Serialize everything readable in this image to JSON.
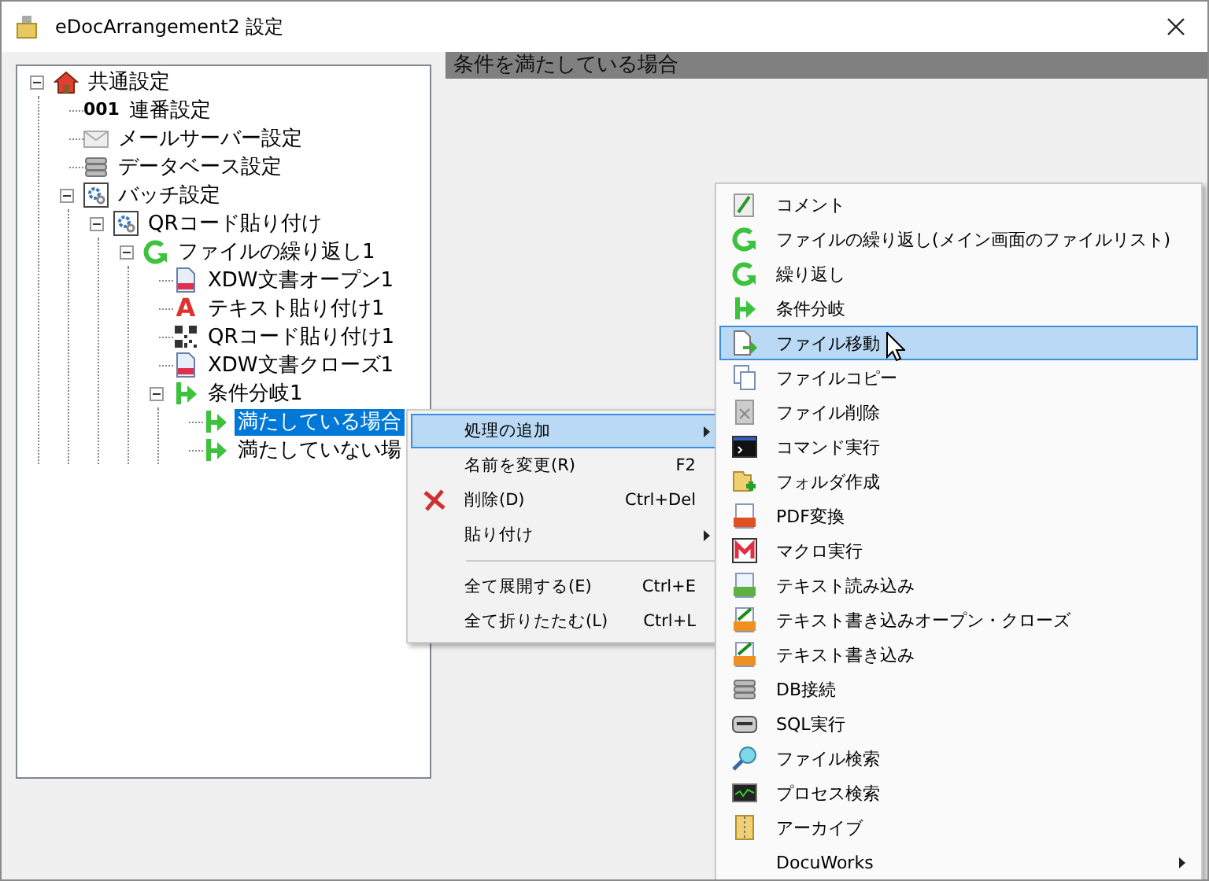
{
  "window": {
    "title": "eDocArrangement2 設定"
  },
  "tree": [
    {
      "label": "共通設定",
      "kind": "house",
      "expanded": true,
      "selected": false,
      "children": [
        {
          "label": "連番設定",
          "kind": "counter",
          "icon_text": "001",
          "selected": false
        },
        {
          "label": "メールサーバー設定",
          "kind": "mail",
          "selected": false
        },
        {
          "label": "データベース設定",
          "kind": "database",
          "selected": false
        },
        {
          "label": "バッチ設定",
          "kind": "batch",
          "expanded": true,
          "selected": false,
          "children": [
            {
              "label": "QRコード貼り付け",
              "kind": "batch",
              "expanded": true,
              "selected": false,
              "children": [
                {
                  "label": "ファイルの繰り返し1",
                  "kind": "loop",
                  "expanded": true,
                  "selected": false,
                  "children": [
                    {
                      "label": "XDW文書オープン1",
                      "kind": "document",
                      "selected": false
                    },
                    {
                      "label": "テキスト貼り付け1",
                      "kind": "letter",
                      "icon_text": "A",
                      "selected": false
                    },
                    {
                      "label": "QRコード貼り付け1",
                      "kind": "qr",
                      "selected": false
                    },
                    {
                      "label": "XDW文書クローズ1",
                      "kind": "document",
                      "selected": false
                    },
                    {
                      "label": "条件分岐1",
                      "kind": "branch",
                      "expanded": true,
                      "selected": false,
                      "children": [
                        {
                          "label": "満たしている場合",
                          "kind": "branch",
                          "selected": true
                        },
                        {
                          "label": "満たしていない場",
                          "kind": "branch",
                          "selected": false
                        }
                      ]
                    }
                  ]
                }
              ]
            }
          ]
        }
      ]
    }
  ],
  "panel": {
    "header": "条件を満たしている場合"
  },
  "context_menu": {
    "items": [
      {
        "kind": "item",
        "label": "処理の追加",
        "selected": true,
        "submenu": true
      },
      {
        "kind": "item",
        "label": "名前を変更(R)",
        "shortcut": "F2",
        "selected": false,
        "submenu": false
      },
      {
        "kind": "delete",
        "label": "削除(D)",
        "shortcut": "Ctrl+Del",
        "selected": false,
        "submenu": false
      },
      {
        "kind": "item",
        "label": "貼り付け",
        "selected": false,
        "submenu": true
      },
      {
        "kind": "separator"
      },
      {
        "kind": "item",
        "label": "全て展開する(E)",
        "shortcut": "Ctrl+E",
        "selected": false,
        "submenu": false
      },
      {
        "kind": "item",
        "label": "全て折りたたむ(L)",
        "shortcut": "Ctrl+L",
        "selected": false,
        "submenu": false
      }
    ]
  },
  "submenu": {
    "items": [
      {
        "label": "コメント",
        "kind": "note",
        "selected": false,
        "submenu": false
      },
      {
        "label": "ファイルの繰り返し(メイン画面のファイルリスト)",
        "kind": "loop",
        "selected": false,
        "submenu": false
      },
      {
        "label": "繰り返し",
        "kind": "loop",
        "selected": false,
        "submenu": false
      },
      {
        "label": "条件分岐",
        "kind": "branch",
        "selected": false,
        "submenu": false
      },
      {
        "label": "ファイル移動",
        "kind": "file-move",
        "selected": true,
        "submenu": false
      },
      {
        "label": "ファイルコピー",
        "kind": "file-copy",
        "selected": false,
        "submenu": false
      },
      {
        "label": "ファイル削除",
        "kind": "file-delete",
        "selected": false,
        "submenu": false
      },
      {
        "label": "コマンド実行",
        "kind": "console",
        "selected": false,
        "submenu": false
      },
      {
        "label": "フォルダ作成",
        "kind": "folder-add",
        "selected": false,
        "submenu": false
      },
      {
        "label": "PDF変換",
        "kind": "pdf",
        "selected": false,
        "submenu": false
      },
      {
        "label": "マクロ実行",
        "kind": "macro",
        "selected": false,
        "submenu": false
      },
      {
        "label": "テキスト読み込み",
        "kind": "txt",
        "selected": false,
        "submenu": false
      },
      {
        "label": "テキスト書き込みオープン・クローズ",
        "kind": "txt-edit",
        "selected": false,
        "submenu": false
      },
      {
        "label": "テキスト書き込み",
        "kind": "txt-edit",
        "selected": false,
        "submenu": false
      },
      {
        "label": "DB接続",
        "kind": "database",
        "selected": false,
        "submenu": false
      },
      {
        "label": "SQL実行",
        "kind": "sql",
        "selected": false,
        "submenu": false
      },
      {
        "label": "ファイル検索",
        "kind": "magnifier",
        "selected": false,
        "submenu": false
      },
      {
        "label": "プロセス検索",
        "kind": "monitor",
        "selected": false,
        "submenu": false
      },
      {
        "label": "アーカイブ",
        "kind": "archive",
        "selected": false,
        "submenu": false
      },
      {
        "label": "DocuWorks",
        "kind": "plain",
        "selected": false,
        "submenu": true
      }
    ]
  }
}
